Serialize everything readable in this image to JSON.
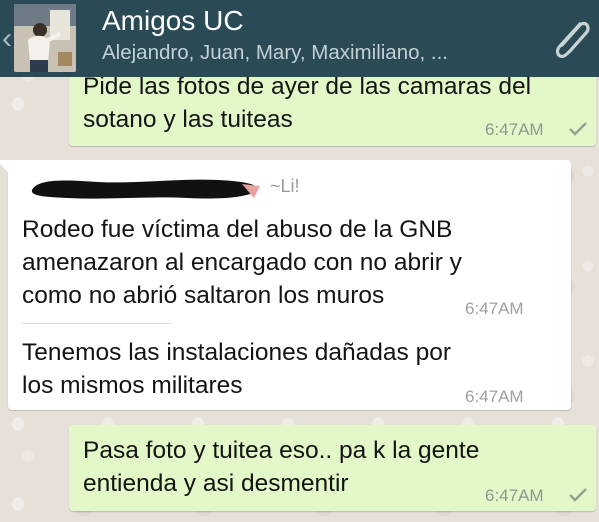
{
  "header": {
    "title": "Amigos UC",
    "subtitle": "Alejandro, Juan, Mary, Maximiliano, ..."
  },
  "messages": [
    {
      "direction": "outgoing",
      "text": "Pide las fotos de ayer de las camaras del\nsotano y las tuiteas",
      "time": "6:47AM"
    },
    {
      "direction": "incoming",
      "sender_tag": "~Li!",
      "text": "Rodeo fue víctima del abuso de la GNB\namenazaron al encargado con no abrir y\ncomo no abrió saltaron los muros",
      "time": "6:47AM"
    },
    {
      "direction": "incoming",
      "text": "Tenemos las instalaciones dañadas por\nlos mismos militares",
      "time": "6:47AM"
    },
    {
      "direction": "outgoing",
      "text": "Pasa foto y tuitea eso.. pa k la gente\nentienda y asi desmentir",
      "time": "6:47AM"
    }
  ],
  "colors": {
    "header_bg": "#2a4a55",
    "outgoing_bubble": "#e2f8c8",
    "incoming_bubble": "#ffffff",
    "chat_background": "#e5ddd5"
  },
  "icons": {
    "back": "chevron-left-icon",
    "attach": "paperclip-icon",
    "sent_status": "check-icon"
  }
}
